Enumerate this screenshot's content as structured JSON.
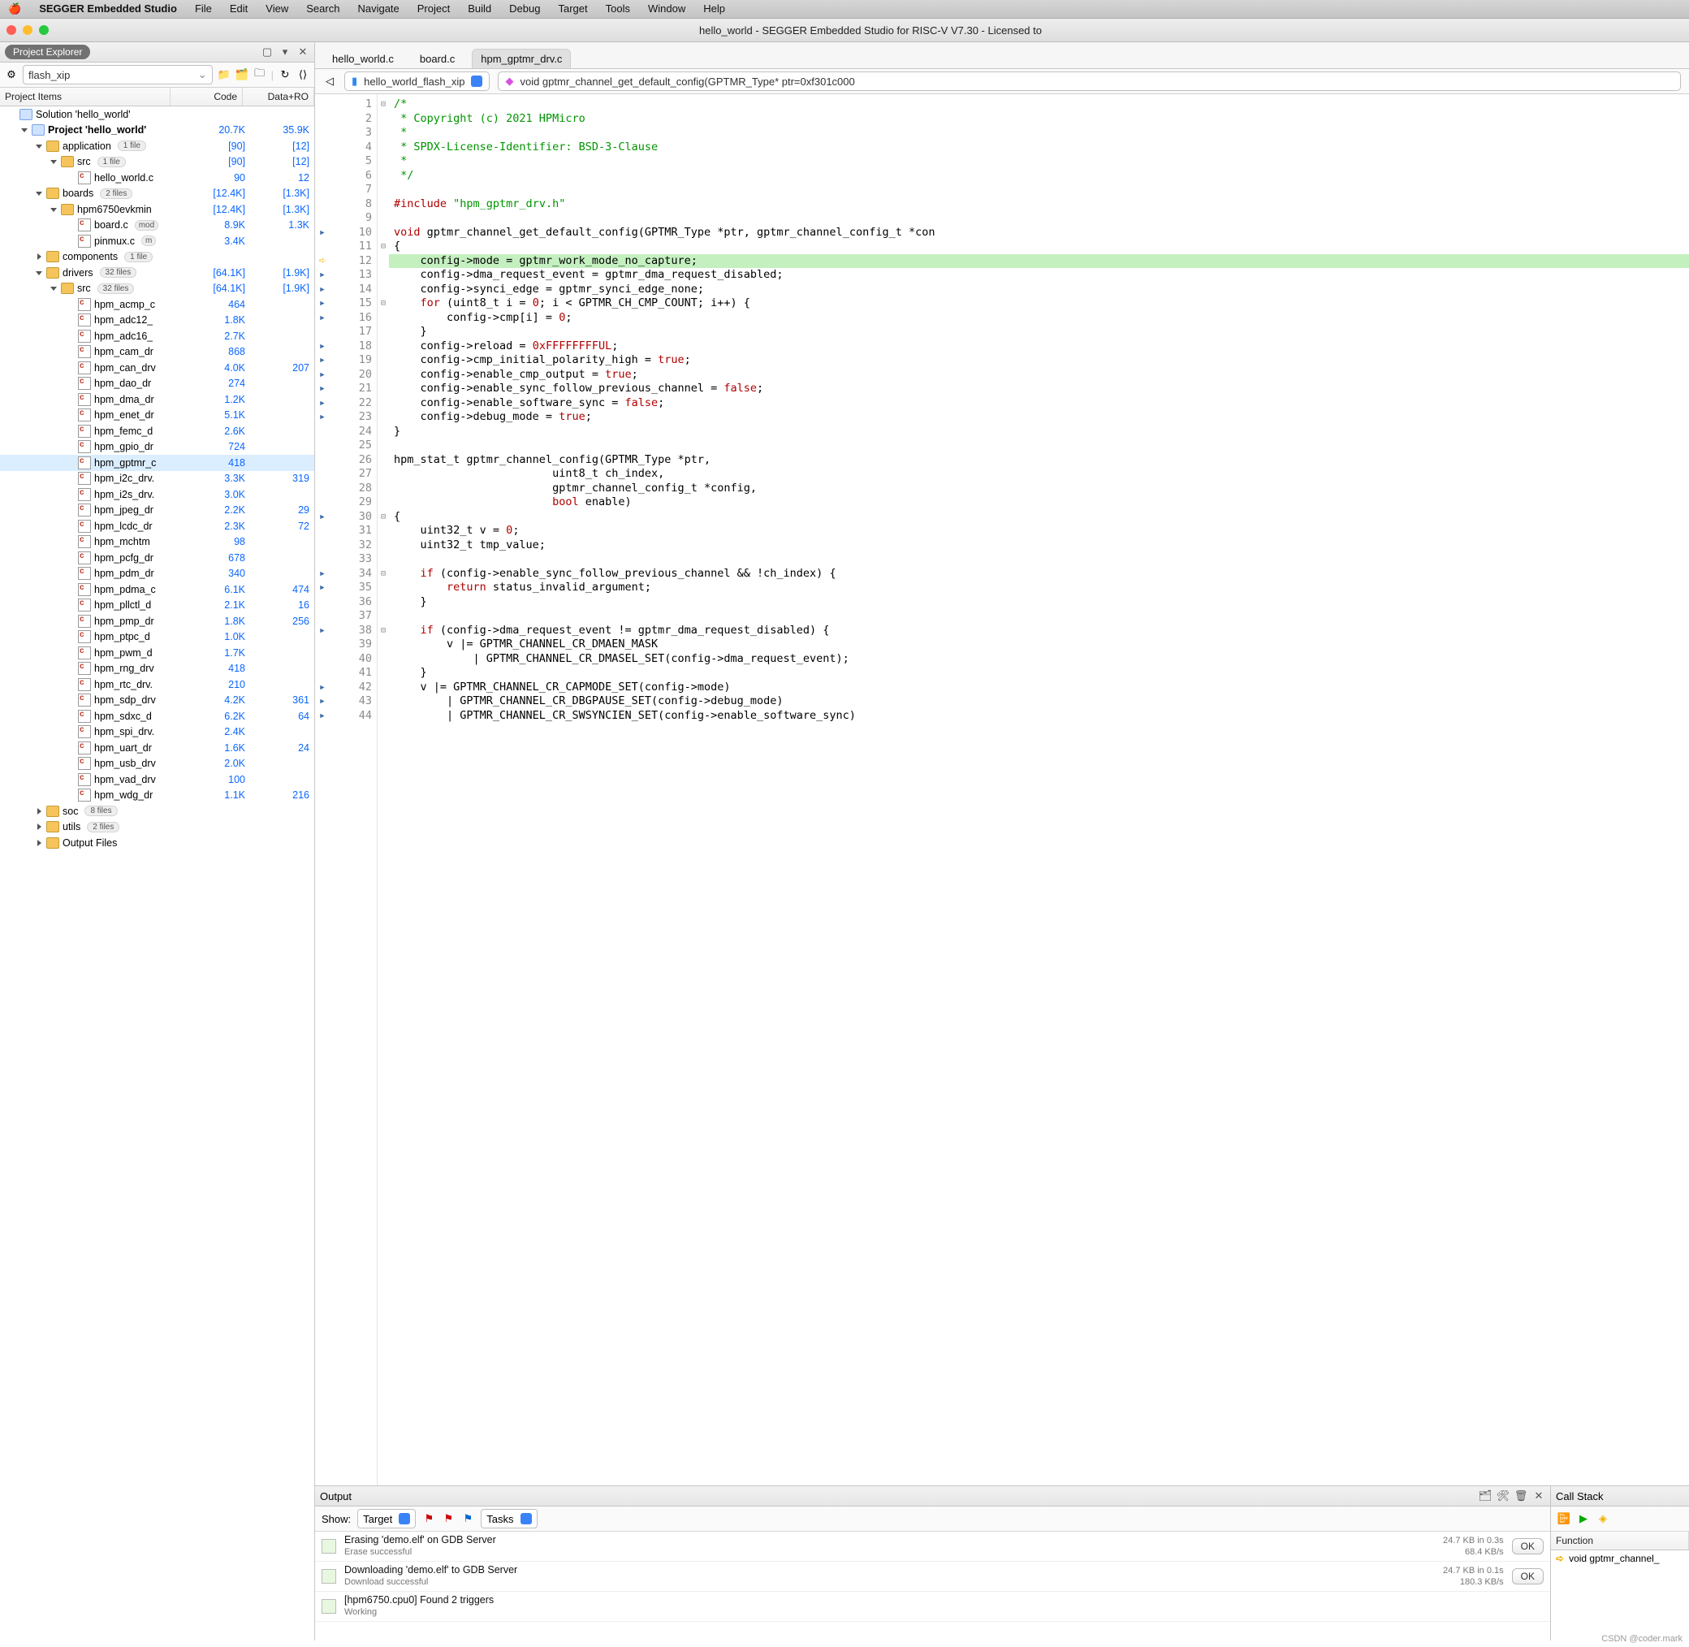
{
  "menubar": [
    "SEGGER Embedded Studio",
    "File",
    "Edit",
    "View",
    "Search",
    "Navigate",
    "Project",
    "Build",
    "Debug",
    "Target",
    "Tools",
    "Window",
    "Help"
  ],
  "window_title": "hello_world - SEGGER Embedded Studio for RISC-V V7.30 - Licensed to",
  "project_explorer": {
    "title": "Project Explorer",
    "combo": "flash_xip",
    "columns": [
      "Project Items",
      "Code",
      "Data+RO"
    ],
    "rows": [
      {
        "indent": 0,
        "tw": "",
        "icon": "box",
        "label": "Solution 'hello_world'",
        "code": "",
        "data": ""
      },
      {
        "indent": 1,
        "tw": "open",
        "icon": "box",
        "bold": true,
        "label": "Project 'hello_world'",
        "code": "20.7K",
        "data": "35.9K"
      },
      {
        "indent": 2,
        "tw": "open",
        "icon": "fldr",
        "label": "application",
        "badge": "1 file",
        "code": "[90]",
        "data": "[12]"
      },
      {
        "indent": 3,
        "tw": "open",
        "icon": "fldr",
        "label": "src",
        "badge": "1 file",
        "code": "[90]",
        "data": "[12]"
      },
      {
        "indent": 4,
        "tw": "",
        "icon": "cfile",
        "label": "hello_world.c",
        "code": "90",
        "data": "12"
      },
      {
        "indent": 2,
        "tw": "open",
        "icon": "fldr",
        "label": "boards",
        "badge": "2 files",
        "code": "[12.4K]",
        "data": "[1.3K]"
      },
      {
        "indent": 3,
        "tw": "open",
        "icon": "fldr",
        "label": "hpm6750evkmin",
        "code": "[12.4K]",
        "data": "[1.3K]"
      },
      {
        "indent": 4,
        "tw": "",
        "icon": "cfile",
        "label": "board.c",
        "mod": "mod",
        "code": "8.9K",
        "data": "1.3K"
      },
      {
        "indent": 4,
        "tw": "",
        "icon": "cfile",
        "label": "pinmux.c",
        "mod": "m",
        "code": "3.4K",
        "data": ""
      },
      {
        "indent": 2,
        "tw": "right",
        "icon": "fldr",
        "label": "components",
        "badge": "1 file",
        "code": "",
        "data": ""
      },
      {
        "indent": 2,
        "tw": "open",
        "icon": "fldr",
        "label": "drivers",
        "badge": "32 files",
        "code": "[64.1K]",
        "data": "[1.9K]"
      },
      {
        "indent": 3,
        "tw": "open",
        "icon": "fldr",
        "label": "src",
        "badge": "32 files",
        "code": "[64.1K]",
        "data": "[1.9K]"
      },
      {
        "indent": 4,
        "tw": "",
        "icon": "cfile",
        "label": "hpm_acmp_c",
        "code": "464",
        "data": ""
      },
      {
        "indent": 4,
        "tw": "",
        "icon": "cfile",
        "label": "hpm_adc12_",
        "code": "1.8K",
        "data": ""
      },
      {
        "indent": 4,
        "tw": "",
        "icon": "cfile",
        "label": "hpm_adc16_",
        "code": "2.7K",
        "data": ""
      },
      {
        "indent": 4,
        "tw": "",
        "icon": "cfile",
        "label": "hpm_cam_dr",
        "code": "868",
        "data": ""
      },
      {
        "indent": 4,
        "tw": "",
        "icon": "cfile",
        "label": "hpm_can_drv",
        "code": "4.0K",
        "data": "207"
      },
      {
        "indent": 4,
        "tw": "",
        "icon": "cfile",
        "label": "hpm_dao_dr",
        "code": "274",
        "data": ""
      },
      {
        "indent": 4,
        "tw": "",
        "icon": "cfile",
        "label": "hpm_dma_dr",
        "code": "1.2K",
        "data": ""
      },
      {
        "indent": 4,
        "tw": "",
        "icon": "cfile",
        "label": "hpm_enet_dr",
        "code": "5.1K",
        "data": ""
      },
      {
        "indent": 4,
        "tw": "",
        "icon": "cfile",
        "label": "hpm_femc_d",
        "code": "2.6K",
        "data": ""
      },
      {
        "indent": 4,
        "tw": "",
        "icon": "cfile",
        "label": "hpm_gpio_dr",
        "code": "724",
        "data": ""
      },
      {
        "indent": 4,
        "tw": "",
        "icon": "cfile",
        "label": "hpm_gptmr_c",
        "code": "418",
        "data": "",
        "selected": true
      },
      {
        "indent": 4,
        "tw": "",
        "icon": "cfile",
        "label": "hpm_i2c_drv.",
        "code": "3.3K",
        "data": "319"
      },
      {
        "indent": 4,
        "tw": "",
        "icon": "cfile",
        "label": "hpm_i2s_drv.",
        "code": "3.0K",
        "data": ""
      },
      {
        "indent": 4,
        "tw": "",
        "icon": "cfile",
        "label": "hpm_jpeg_dr",
        "code": "2.2K",
        "data": "29"
      },
      {
        "indent": 4,
        "tw": "",
        "icon": "cfile",
        "label": "hpm_lcdc_dr",
        "code": "2.3K",
        "data": "72"
      },
      {
        "indent": 4,
        "tw": "",
        "icon": "cfile",
        "label": "hpm_mchtm",
        "code": "98",
        "data": ""
      },
      {
        "indent": 4,
        "tw": "",
        "icon": "cfile",
        "label": "hpm_pcfg_dr",
        "code": "678",
        "data": ""
      },
      {
        "indent": 4,
        "tw": "",
        "icon": "cfile",
        "label": "hpm_pdm_dr",
        "code": "340",
        "data": ""
      },
      {
        "indent": 4,
        "tw": "",
        "icon": "cfile",
        "label": "hpm_pdma_c",
        "code": "6.1K",
        "data": "474"
      },
      {
        "indent": 4,
        "tw": "",
        "icon": "cfile",
        "label": "hpm_pllctl_d",
        "code": "2.1K",
        "data": "16"
      },
      {
        "indent": 4,
        "tw": "",
        "icon": "cfile",
        "label": "hpm_pmp_dr",
        "code": "1.8K",
        "data": "256"
      },
      {
        "indent": 4,
        "tw": "",
        "icon": "cfile",
        "label": "hpm_ptpc_d",
        "code": "1.0K",
        "data": ""
      },
      {
        "indent": 4,
        "tw": "",
        "icon": "cfile",
        "label": "hpm_pwm_d",
        "code": "1.7K",
        "data": ""
      },
      {
        "indent": 4,
        "tw": "",
        "icon": "cfile",
        "label": "hpm_rng_drv",
        "code": "418",
        "data": ""
      },
      {
        "indent": 4,
        "tw": "",
        "icon": "cfile",
        "label": "hpm_rtc_drv.",
        "code": "210",
        "data": ""
      },
      {
        "indent": 4,
        "tw": "",
        "icon": "cfile",
        "label": "hpm_sdp_drv",
        "code": "4.2K",
        "data": "361"
      },
      {
        "indent": 4,
        "tw": "",
        "icon": "cfile",
        "label": "hpm_sdxc_d",
        "code": "6.2K",
        "data": "64"
      },
      {
        "indent": 4,
        "tw": "",
        "icon": "cfile",
        "label": "hpm_spi_drv.",
        "code": "2.4K",
        "data": ""
      },
      {
        "indent": 4,
        "tw": "",
        "icon": "cfile",
        "label": "hpm_uart_dr",
        "code": "1.6K",
        "data": "24"
      },
      {
        "indent": 4,
        "tw": "",
        "icon": "cfile",
        "label": "hpm_usb_drv",
        "code": "2.0K",
        "data": ""
      },
      {
        "indent": 4,
        "tw": "",
        "icon": "cfile",
        "label": "hpm_vad_drv",
        "code": "100",
        "data": ""
      },
      {
        "indent": 4,
        "tw": "",
        "icon": "cfile",
        "label": "hpm_wdg_dr",
        "code": "1.1K",
        "data": "216"
      },
      {
        "indent": 2,
        "tw": "right",
        "icon": "fldr",
        "label": "soc",
        "badge": "8 files",
        "code": "",
        "data": ""
      },
      {
        "indent": 2,
        "tw": "right",
        "icon": "fldr",
        "label": "utils",
        "badge": "2 files",
        "code": "",
        "data": ""
      },
      {
        "indent": 2,
        "tw": "right",
        "icon": "fldr",
        "label": "Output Files",
        "code": "",
        "data": ""
      }
    ]
  },
  "editor": {
    "tabs": [
      {
        "label": "hello_world.c",
        "active": false
      },
      {
        "label": "board.c",
        "active": false
      },
      {
        "label": "hpm_gptmr_drv.c",
        "active": true
      }
    ],
    "crumb_project": "hello_world_flash_xip",
    "crumb_function": "void gptmr_channel_get_default_config(GPTMR_Type* ptr=0xf301c000",
    "lines": [
      {
        "n": 1,
        "raw": [
          [
            "g",
            "/*"
          ]
        ]
      },
      {
        "n": 2,
        "raw": [
          [
            "g",
            " * Copyright (c) 2021 HPMicro"
          ]
        ]
      },
      {
        "n": 3,
        "raw": [
          [
            "g",
            " *"
          ]
        ]
      },
      {
        "n": 4,
        "raw": [
          [
            "g",
            " * SPDX-License-Identifier: BSD-3-Clause"
          ]
        ]
      },
      {
        "n": 5,
        "raw": [
          [
            "g",
            " *"
          ]
        ]
      },
      {
        "n": 6,
        "raw": [
          [
            "g",
            " */"
          ]
        ]
      },
      {
        "n": 7,
        "raw": [
          [
            "k",
            ""
          ]
        ]
      },
      {
        "n": 8,
        "raw": [
          [
            "r",
            "#include "
          ],
          [
            "g",
            "\"hpm_gptmr_drv.h\""
          ]
        ]
      },
      {
        "n": 9,
        "raw": [
          [
            "k",
            ""
          ]
        ]
      },
      {
        "n": 10,
        "raw": [
          [
            "r",
            "void"
          ],
          [
            "k",
            " gptmr_channel_get_default_config(GPTMR_Type *ptr, gptmr_channel_config_t *con"
          ]
        ]
      },
      {
        "n": 11,
        "raw": [
          [
            "k",
            "{"
          ]
        ]
      },
      {
        "n": 12,
        "hl": true,
        "cur": true,
        "raw": [
          [
            "k",
            "    config->mode = gptmr_work_mode_no_capture;"
          ]
        ]
      },
      {
        "n": 13,
        "raw": [
          [
            "k",
            "    config->dma_request_event = gptmr_dma_request_disabled;"
          ]
        ]
      },
      {
        "n": 14,
        "raw": [
          [
            "k",
            "    config->synci_edge = gptmr_synci_edge_none;"
          ]
        ]
      },
      {
        "n": 15,
        "raw": [
          [
            "r",
            "    for "
          ],
          [
            "k",
            "(uint8_t i = "
          ],
          [
            "r",
            "0"
          ],
          [
            "k",
            "; i < GPTMR_CH_CMP_COUNT; i++) {"
          ]
        ]
      },
      {
        "n": 16,
        "raw": [
          [
            "k",
            "        config->cmp[i] = "
          ],
          [
            "r",
            "0"
          ],
          [
            "k",
            ";"
          ]
        ]
      },
      {
        "n": 17,
        "raw": [
          [
            "k",
            "    }"
          ]
        ]
      },
      {
        "n": 18,
        "raw": [
          [
            "k",
            "    config->reload = "
          ],
          [
            "r",
            "0xFFFFFFFFUL"
          ],
          [
            "k",
            ";"
          ]
        ]
      },
      {
        "n": 19,
        "raw": [
          [
            "k",
            "    config->cmp_initial_polarity_high = "
          ],
          [
            "r",
            "true"
          ],
          [
            "k",
            ";"
          ]
        ]
      },
      {
        "n": 20,
        "raw": [
          [
            "k",
            "    config->enable_cmp_output = "
          ],
          [
            "r",
            "true"
          ],
          [
            "k",
            ";"
          ]
        ]
      },
      {
        "n": 21,
        "raw": [
          [
            "k",
            "    config->enable_sync_follow_previous_channel = "
          ],
          [
            "r",
            "false"
          ],
          [
            "k",
            ";"
          ]
        ]
      },
      {
        "n": 22,
        "raw": [
          [
            "k",
            "    config->enable_software_sync = "
          ],
          [
            "r",
            "false"
          ],
          [
            "k",
            ";"
          ]
        ]
      },
      {
        "n": 23,
        "raw": [
          [
            "k",
            "    config->debug_mode = "
          ],
          [
            "r",
            "true"
          ],
          [
            "k",
            ";"
          ]
        ]
      },
      {
        "n": 24,
        "raw": [
          [
            "k",
            "}"
          ]
        ]
      },
      {
        "n": 25,
        "raw": [
          [
            "k",
            ""
          ]
        ]
      },
      {
        "n": 26,
        "raw": [
          [
            "k",
            "hpm_stat_t gptmr_channel_config(GPTMR_Type *ptr,"
          ]
        ]
      },
      {
        "n": 27,
        "raw": [
          [
            "k",
            "                        uint8_t ch_index,"
          ]
        ]
      },
      {
        "n": 28,
        "raw": [
          [
            "k",
            "                        gptmr_channel_config_t *config,"
          ]
        ]
      },
      {
        "n": 29,
        "raw": [
          [
            "r",
            "                        bool"
          ],
          [
            "k",
            " enable)"
          ]
        ]
      },
      {
        "n": 30,
        "raw": [
          [
            "k",
            "{"
          ]
        ]
      },
      {
        "n": 31,
        "raw": [
          [
            "k",
            "    uint32_t v = "
          ],
          [
            "r",
            "0"
          ],
          [
            "k",
            ";"
          ]
        ]
      },
      {
        "n": 32,
        "raw": [
          [
            "k",
            "    uint32_t tmp_value;"
          ]
        ]
      },
      {
        "n": 33,
        "raw": [
          [
            "k",
            ""
          ]
        ]
      },
      {
        "n": 34,
        "raw": [
          [
            "r",
            "    if "
          ],
          [
            "k",
            "(config->enable_sync_follow_previous_channel && !ch_index) {"
          ]
        ]
      },
      {
        "n": 35,
        "raw": [
          [
            "r",
            "        return"
          ],
          [
            "k",
            " status_invalid_argument;"
          ]
        ]
      },
      {
        "n": 36,
        "raw": [
          [
            "k",
            "    }"
          ]
        ]
      },
      {
        "n": 37,
        "raw": [
          [
            "k",
            ""
          ]
        ]
      },
      {
        "n": 38,
        "raw": [
          [
            "r",
            "    if "
          ],
          [
            "k",
            "(config->dma_request_event != gptmr_dma_request_disabled) {"
          ]
        ]
      },
      {
        "n": 39,
        "raw": [
          [
            "k",
            "        v |= GPTMR_CHANNEL_CR_DMAEN_MASK"
          ]
        ]
      },
      {
        "n": 40,
        "raw": [
          [
            "k",
            "            | GPTMR_CHANNEL_CR_DMASEL_SET(config->dma_request_event);"
          ]
        ]
      },
      {
        "n": 41,
        "raw": [
          [
            "k",
            "    }"
          ]
        ]
      },
      {
        "n": 42,
        "raw": [
          [
            "k",
            "    v |= GPTMR_CHANNEL_CR_CAPMODE_SET(config->mode)"
          ]
        ]
      },
      {
        "n": 43,
        "raw": [
          [
            "k",
            "        | GPTMR_CHANNEL_CR_DBGPAUSE_SET(config->debug_mode)"
          ]
        ]
      },
      {
        "n": 44,
        "raw": [
          [
            "k",
            "        | GPTMR_CHANNEL_CR_SWSYNCIEN_SET(config->enable_software_sync)"
          ]
        ]
      }
    ]
  },
  "output": {
    "title": "Output",
    "show_label": "Show:",
    "show_value": "Target",
    "tasks_label": "Tasks",
    "items": [
      {
        "t1": "Erasing 'demo.elf' on GDB Server",
        "t2": "Erase successful",
        "m1": "24.7 KB in 0.3s",
        "m2": "68.4 KB/s",
        "ok": "OK"
      },
      {
        "t1": "Downloading 'demo.elf' to GDB Server",
        "t2": "Download successful",
        "m1": "24.7 KB in 0.1s",
        "m2": "180.3 KB/s",
        "ok": "OK"
      },
      {
        "t1": "[hpm6750.cpu0] Found 2 triggers",
        "t2": "Working",
        "m1": "",
        "m2": "",
        "ok": ""
      }
    ]
  },
  "callstack": {
    "title": "Call Stack",
    "header": "Function",
    "items": [
      "void gptmr_channel_"
    ]
  },
  "watermark": "CSDN @coder.mark"
}
